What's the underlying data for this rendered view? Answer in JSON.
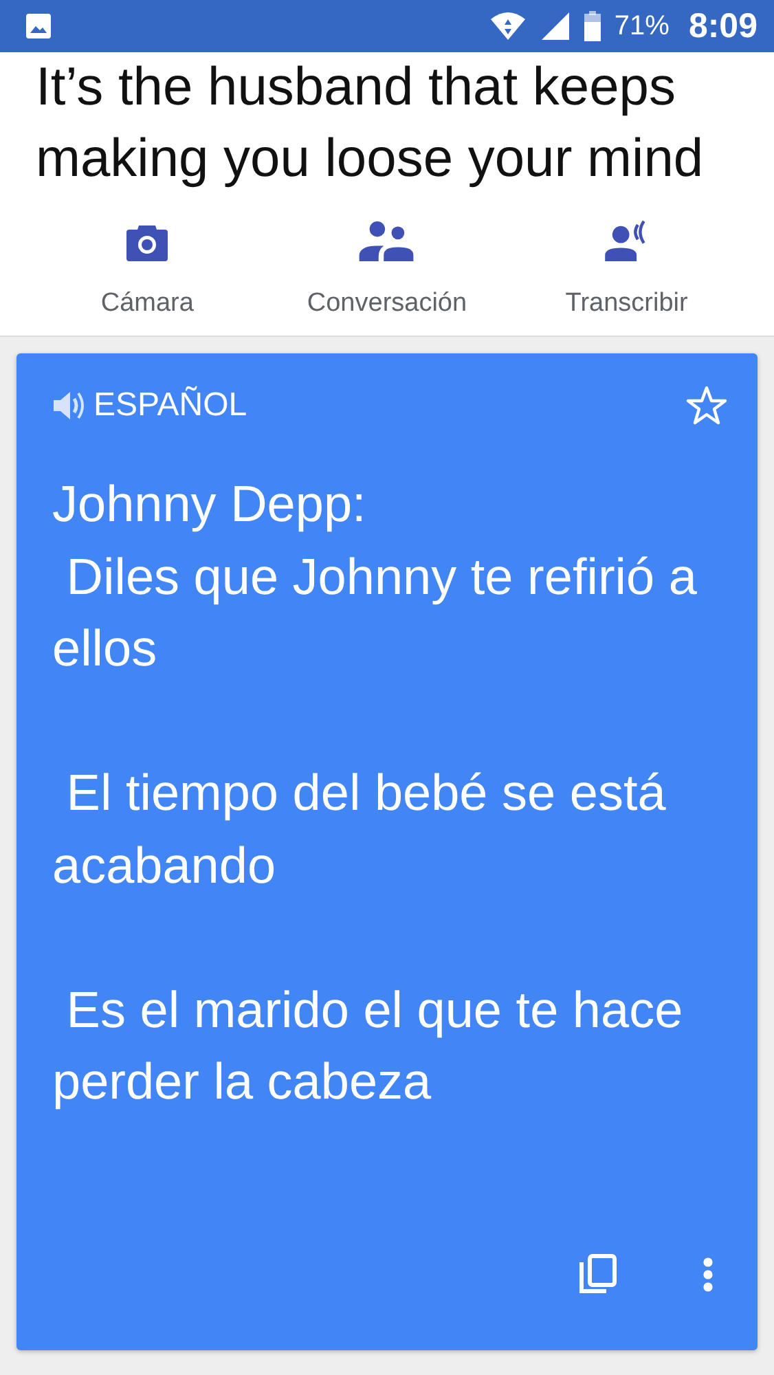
{
  "status_bar": {
    "battery": "71%",
    "time": "8:09"
  },
  "source_text": "It’s the husband that keeps making you loose your mind",
  "tools": [
    {
      "kind": "camera",
      "label": "Cámara"
    },
    {
      "kind": "conversation",
      "label": "Conversación"
    },
    {
      "kind": "transcribe",
      "label": "Transcribir"
    }
  ],
  "translation": {
    "language": "ESPAÑOL",
    "text": "Johnny Depp:\n Diles que Johnny te refirió a ellos\n\n El tiempo del bebé se está acabando\n\n Es el marido el que te hace perder la cabeza"
  }
}
